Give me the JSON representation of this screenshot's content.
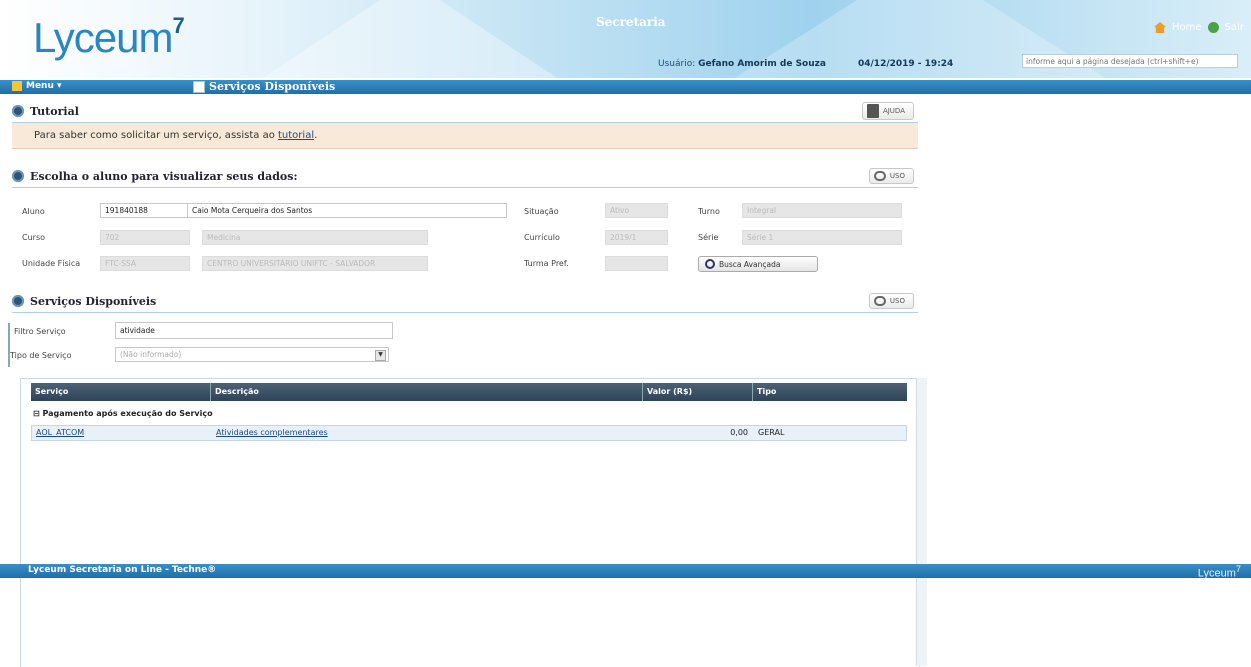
{
  "header": {
    "logo": "Lyceum",
    "logo_mark": "7",
    "app_title": "Secretaria",
    "user_label": "Usuário:",
    "user_name": "Gefano Amorim de Souza",
    "datetime": "04/12/2019 - 19:24",
    "home_label": "Home",
    "exit_label": "Sair",
    "search_placeholder": "informe aqui a página desejada (ctrl+shift+e)"
  },
  "nav": {
    "menu_label": "Menu ▾",
    "page_title": "Serviços Disponíveis"
  },
  "tutorial": {
    "title": "Tutorial",
    "help_label": "AJUDA",
    "text_prefix": "Para saber como solicitar um serviço, assista ao ",
    "link": "tutorial",
    "text_suffix": "."
  },
  "student": {
    "title": "Escolha o aluno para visualizar seus dados:",
    "use_label": "USO",
    "fields": {
      "aluno_label": "Aluno",
      "aluno_id": "191840188",
      "aluno_name": "Caio Mota Cerqueira dos Santos",
      "curso_label": "Curso",
      "curso_code": "702",
      "curso_name": "Medicina",
      "unidade_label": "Unidade Física",
      "unidade_code": "FTC-SSA",
      "unidade_name": "CENTRO UNIVERSITÁRIO UNIFTC - SALVADOR",
      "situacao_label": "Situação",
      "situacao_value": "Ativo",
      "curriculo_label": "Currículo",
      "curriculo_value": "2019/1",
      "turma_label": "Turma Pref.",
      "turma_value": "",
      "turno_label": "Turno",
      "turno_value": "Integral",
      "serie_label": "Série",
      "serie_value": "Série 1",
      "busca_label": "Busca Avançada"
    }
  },
  "services": {
    "title": "Serviços Disponíveis",
    "use_label": "USO",
    "filter_label": "Filtro Serviço",
    "filter_value": "atividade",
    "type_label": "Tipo de Serviço",
    "type_value": "(Não informado)",
    "columns": [
      "Serviço",
      "Descrição",
      "Valor (R$)",
      "Tipo"
    ],
    "group_label": "⊟ Pagamento após execução do Serviço",
    "rows": [
      {
        "servico": "AOL_ATCOM",
        "descricao": "Atividades complementares",
        "valor": "0,00",
        "tipo": "GERAL"
      }
    ]
  },
  "footer": {
    "text": "Lyceum Secretaria on Line - Techne®",
    "logo": "Lyceum",
    "logo_mark": "7"
  }
}
